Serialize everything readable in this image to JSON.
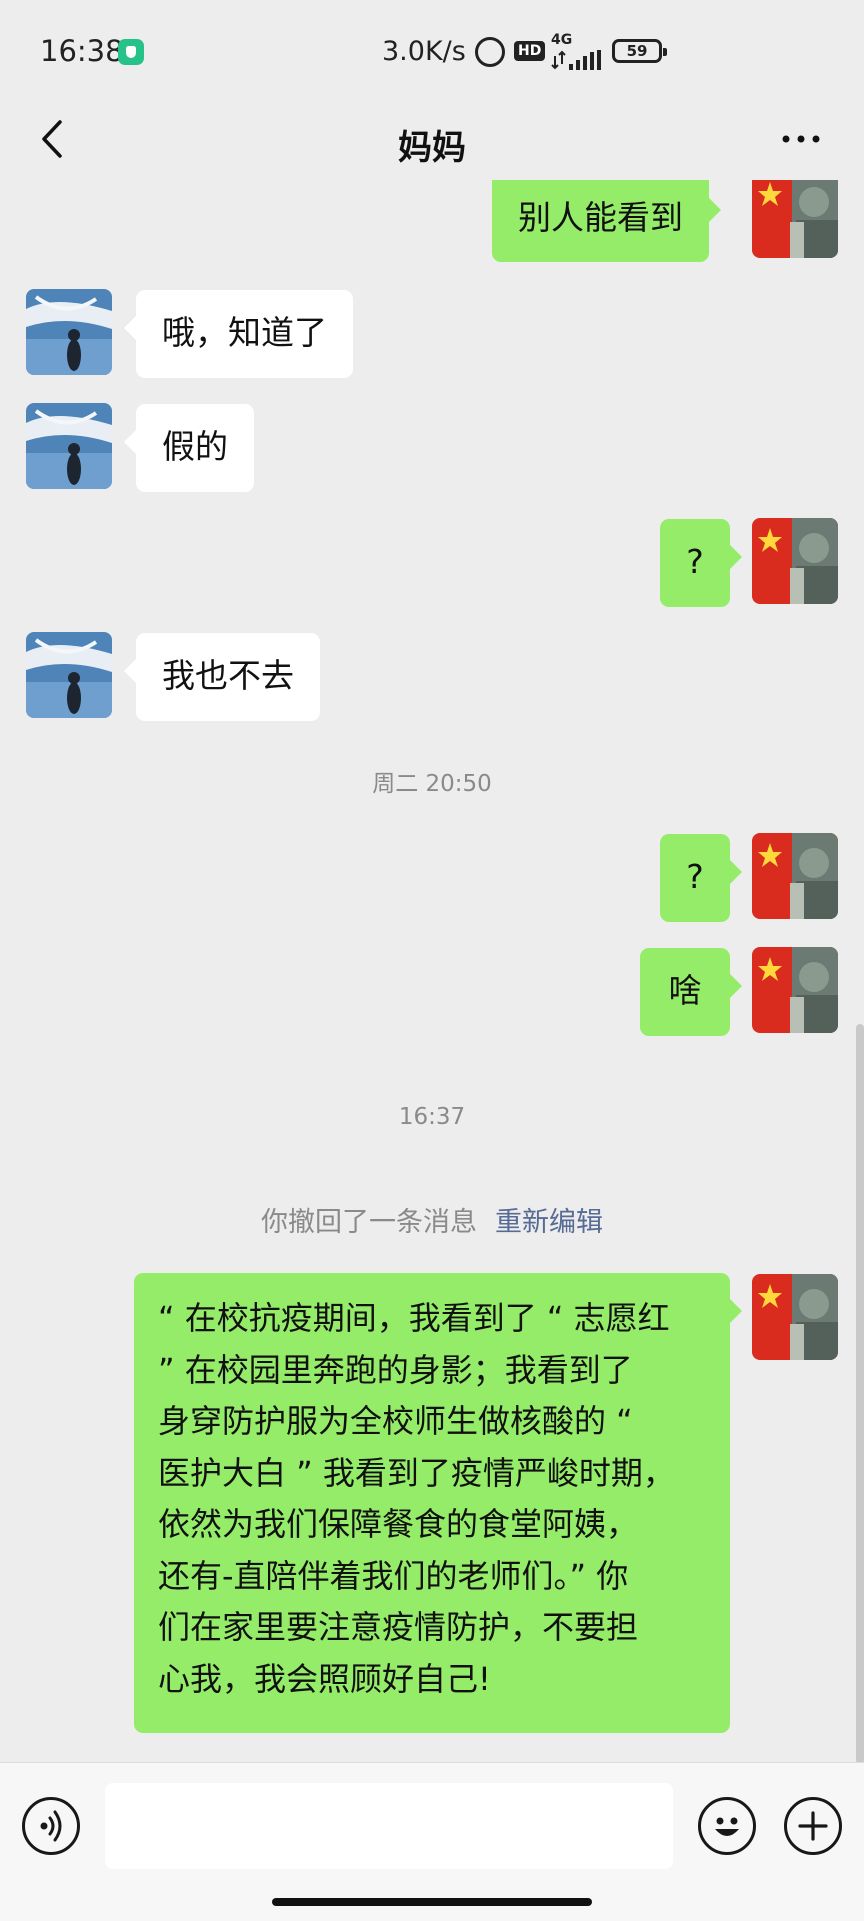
{
  "status_bar": {
    "time": "16:38",
    "speed": "3.0K/s",
    "hd": "HD",
    "network": "4G",
    "battery": "59"
  },
  "header": {
    "title": "妈妈"
  },
  "messages": [
    {
      "side": "right",
      "text": "别人能看到"
    },
    {
      "side": "left",
      "text": "哦，知道了"
    },
    {
      "side": "left",
      "text": "假的"
    },
    {
      "side": "right",
      "text": "?"
    },
    {
      "side": "left",
      "text": "我也不去"
    },
    {
      "side": "right",
      "text": "?"
    },
    {
      "side": "right",
      "text": "啥"
    },
    {
      "side": "right",
      "lines": [
        "“ 在校抗疫期间，我看到了 “ 志愿红",
        "” 在校园里奔跑的身影；我看到了",
        "身穿防护服为全校师生做核酸的 “",
        "医护大白 ” 我看到了疫情严峻时期，",
        "依然为我们保障餐食的食堂阿姨，",
        "还有-直陪伴着我们的老师们。” 你",
        "们在家里要注意疫情防护，不要担",
        "心我，我会照顾好自己!"
      ]
    }
  ],
  "timestamps": [
    "周二 20:50",
    "16:37"
  ],
  "recall": {
    "text": "你撤回了一条消息",
    "edit_label": "重新编辑"
  },
  "colors": {
    "outgoing_bubble": "#95ec69",
    "incoming_bubble": "#ffffff",
    "background": "#ededed",
    "link": "#576b95"
  }
}
